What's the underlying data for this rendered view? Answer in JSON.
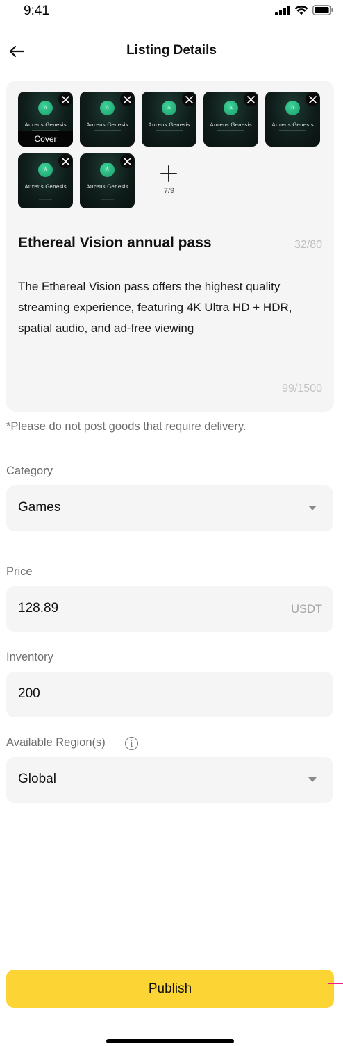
{
  "status_bar": {
    "time": "9:41"
  },
  "nav": {
    "title": "Listing Details"
  },
  "photos": {
    "items": [
      {
        "brand": "Aureus Genesis",
        "logo_letter": "A",
        "cover_label": "Cover"
      },
      {
        "brand": "Aureus Genesis",
        "logo_letter": "A"
      },
      {
        "brand": "Aureus Genesis",
        "logo_letter": "A"
      },
      {
        "brand": "Aureus Genesis",
        "logo_letter": "A"
      },
      {
        "brand": "Aureus Genesis",
        "logo_letter": "A"
      },
      {
        "brand": "Aureus Genesis",
        "logo_letter": "A"
      },
      {
        "brand": "Aureus Genesis",
        "logo_letter": "A"
      }
    ],
    "count_label": "7/9"
  },
  "listing": {
    "title": "Ethereal Vision annual pass",
    "title_count": "32/80",
    "description": "The Ethereal Vision pass offers the highest quality streaming experience, featuring 4K Ultra HD + HDR, spatial audio, and ad-free viewing",
    "description_count": "99/1500"
  },
  "notice": "*Please do not post goods that require delivery.",
  "category": {
    "label": "Category",
    "value": "Games"
  },
  "price": {
    "label": "Price",
    "value": "128.89",
    "unit": "USDT"
  },
  "inventory": {
    "label": "Inventory",
    "value": "200"
  },
  "region": {
    "label": "Available Region(s)",
    "value": "Global",
    "info_icon": "i"
  },
  "publish": {
    "label": "Publish"
  },
  "colors": {
    "accent": "#fcd535",
    "card_bg": "#f5f5f5",
    "muted_text": "#6e6e6e"
  }
}
